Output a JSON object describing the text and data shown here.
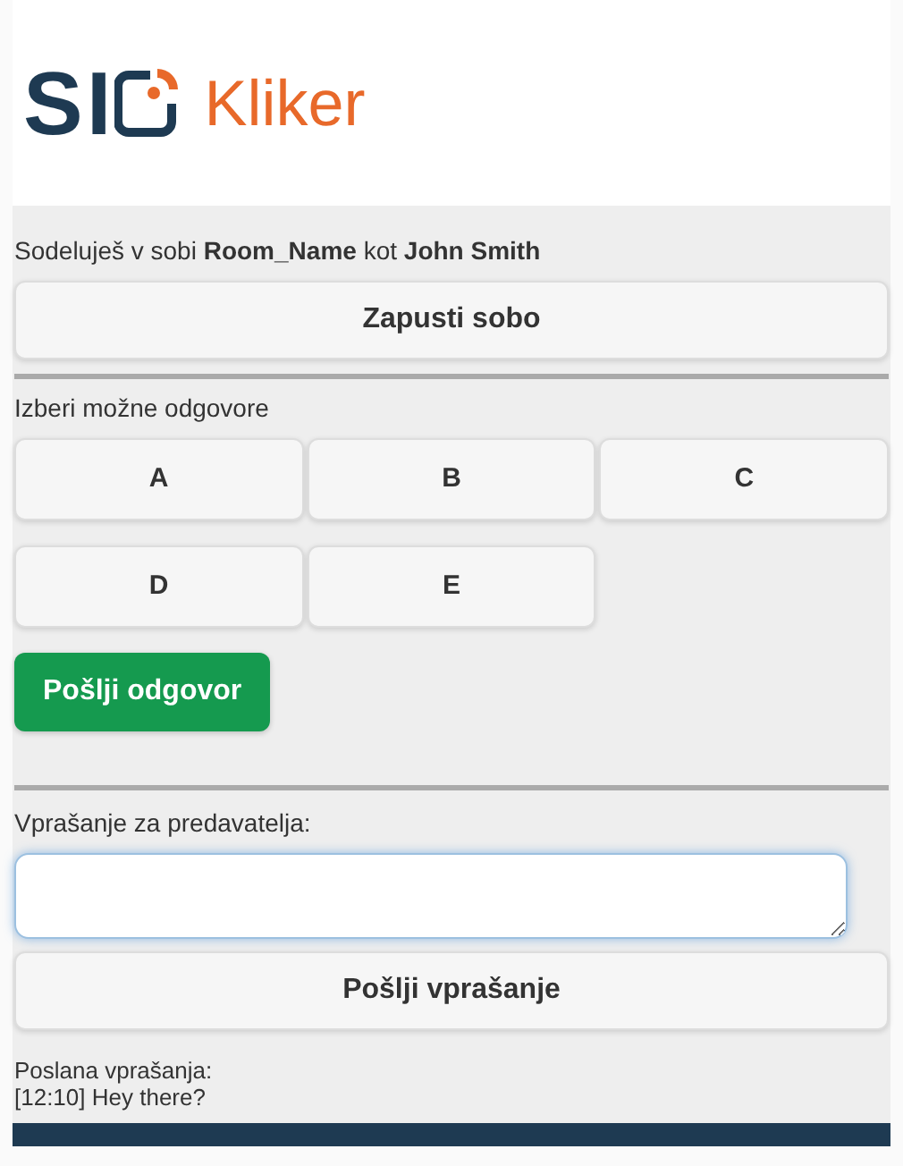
{
  "header": {
    "logo_text": "SI",
    "app_name": "Kliker"
  },
  "room": {
    "intro": "Sodeluješ v sobi **Room_Name** kot **John Smith**",
    "start_button": "Zapusti sobo"
  },
  "answers": {
    "label": "Izberi možne odgovore",
    "options": [
      {
        "label": "A",
        "selected": false
      },
      {
        "label": "B",
        "selected": false
      },
      {
        "label": "C",
        "selected": false
      },
      {
        "label": "D",
        "selected": false
      },
      {
        "label": "E",
        "selected": false
      }
    ],
    "submit_button": "Pošlji odgovor"
  },
  "question": {
    "label": "Vprašanje za predavatelja:",
    "submit_button": "Pošlji vprašanje"
  },
  "sent": {
    "label": "Poslana vprašanja:",
    "items": [
      "[12:10] Hey there?"
    ]
  }
}
